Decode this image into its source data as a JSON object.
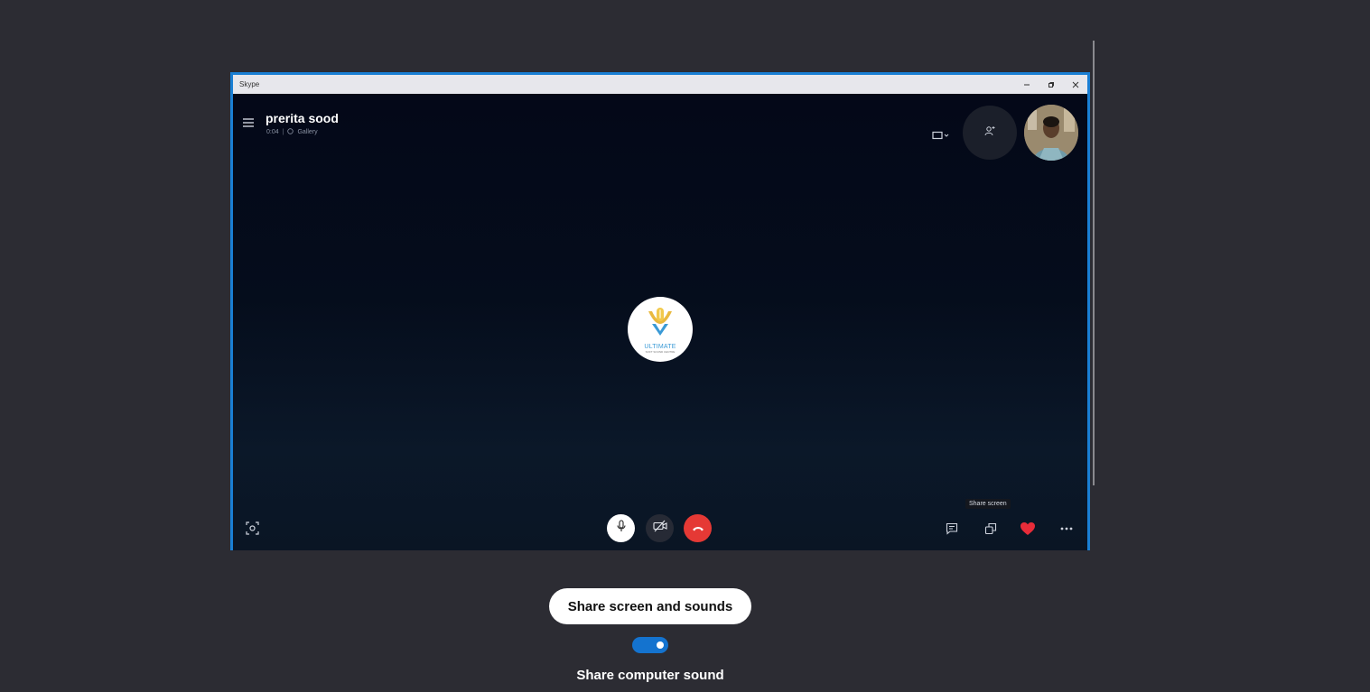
{
  "preview": {
    "window_title": "Skype",
    "caller_name": "prerita sood",
    "call_duration": "0:04",
    "view_mode": "Gallery",
    "tooltip": "Share screen",
    "center_logo_text": "ULTIMATE",
    "center_logo_subtext": "SOFT SOUND CENTRE"
  },
  "share_button_label": "Share screen and sounds",
  "toggle": {
    "label": "Share computer sound",
    "checked": true
  },
  "colors": {
    "background": "#2c2c33",
    "frame_border": "#1a7fd4",
    "toggle_on": "#1473cf",
    "hangup": "#e53935",
    "heart": "#e82c39"
  }
}
